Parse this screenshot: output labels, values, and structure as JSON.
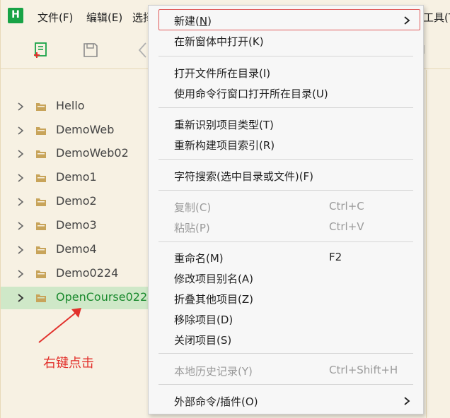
{
  "app": {
    "logo_letter": "H",
    "menus": [
      "文件(F)",
      "编辑(E)",
      "选择"
    ],
    "menu_tools": "工具(T"
  },
  "sidebar": {
    "items": [
      {
        "label": "Hello"
      },
      {
        "label": "DemoWeb"
      },
      {
        "label": "DemoWeb02"
      },
      {
        "label": "Demo1"
      },
      {
        "label": "Demo2"
      },
      {
        "label": "Demo3"
      },
      {
        "label": "Demo4"
      },
      {
        "label": "Demo0224"
      },
      {
        "label": "OpenCourse0224",
        "selected": true
      }
    ]
  },
  "annotation": {
    "text": "右键点击",
    "color": "#e2312c"
  },
  "context_menu": {
    "new": {
      "label_before": "新建(",
      "mnemonic": "N",
      "label_after": ")"
    },
    "open_new_window": "在新窗体中打开(K)",
    "open_folder": "打开文件所在目录(I)",
    "open_cmd": "使用命令行窗口打开所在目录(U)",
    "reidentify": "重新识别项目类型(T)",
    "rebuild_index": "重新构建项目索引(R)",
    "char_search": "字符搜索(选中目录或文件)(F)",
    "copy": {
      "label": "复制(C)",
      "shortcut": "Ctrl+C",
      "disabled": true
    },
    "paste": {
      "label": "粘贴(P)",
      "shortcut": "Ctrl+V",
      "disabled": true
    },
    "rename": {
      "label": "重命名(M)",
      "shortcut": "F2"
    },
    "alias": "修改项目别名(A)",
    "collapse_others": "折叠其他项目(Z)",
    "remove": "移除项目(D)",
    "close": "关闭项目(S)",
    "history": {
      "label": "本地历史记录(Y)",
      "shortcut": "Ctrl+Shift+H",
      "disabled": true
    },
    "external": "外部命令/插件(O)"
  },
  "colors": {
    "accent_green": "#18a346",
    "selected_bg": "#cfe8c8",
    "highlight_border": "#e05a5a"
  }
}
